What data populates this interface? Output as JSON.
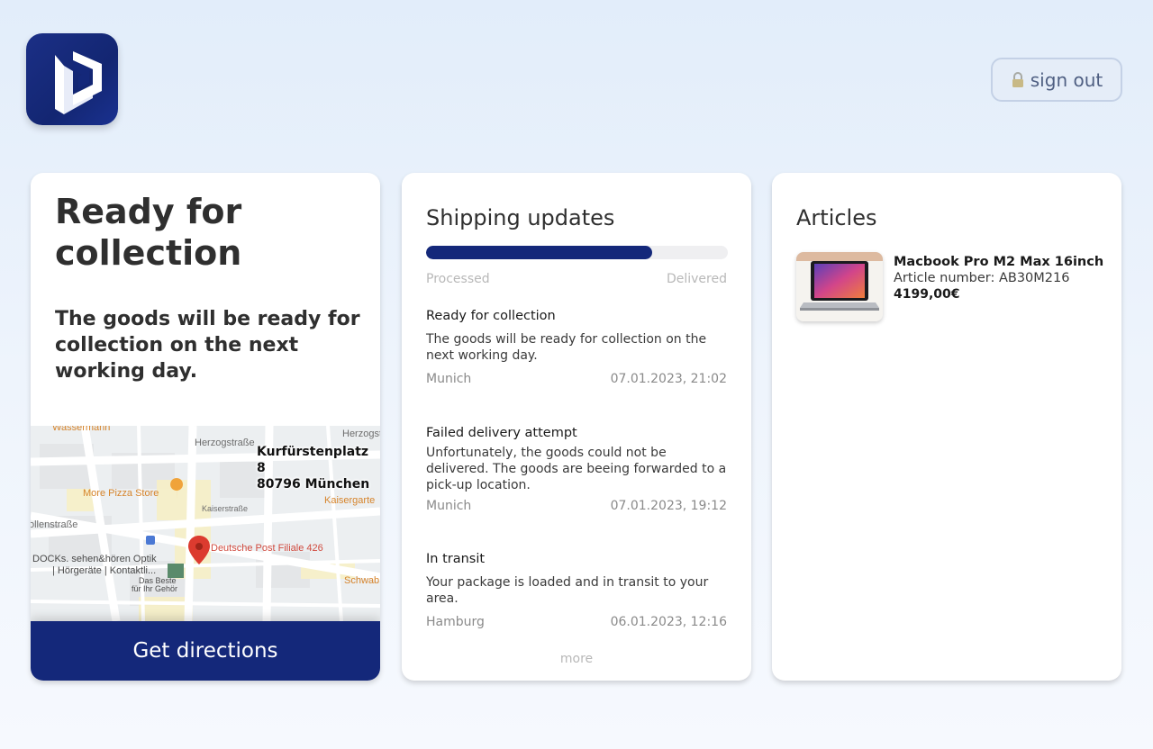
{
  "header": {
    "signout_label": "sign out"
  },
  "status_card": {
    "title": "Ready for collection",
    "description": "The goods will be ready for collection on the next working day.",
    "address_line1": "Kurfürstenplatz 8",
    "address_line2": "80796 München",
    "directions_label": "Get directions",
    "map_labels": {
      "poi_pizza": "More Pizza Store",
      "poi_post": "Deutsche Post Filiale 426",
      "poi_optik": "DOCKs. sehen&hören Optik",
      "poi_optik2": "| Hörgeräte | Kontaktli...",
      "poi_das_beste": "Das Beste",
      "poi_gehoer": "für Ihr Gehör",
      "street_herzog": "Herzogstraße",
      "street_herzog2": "Herzogst",
      "street_kaiser": "Kaiserstraße",
      "street_kaiser2": "Kaisergarte",
      "street_wassermann": "Wassermann",
      "street_ollen": "ollenstraße",
      "street_schwab": "Schwab"
    }
  },
  "shipping": {
    "title": "Shipping updates",
    "progress": 0.75,
    "progress_start": "Processed",
    "progress_end": "Delivered",
    "updates": [
      {
        "title": "Ready for collection",
        "text": "The goods will be ready for collection on the next working day.",
        "location": "Munich",
        "datetime": "07.01.2023, 21:02"
      },
      {
        "title": "Failed delivery attempt",
        "text": "Unfortunately, the goods could not be delivered. The goods are beeing forwarded to a pick-up location.",
        "location": "Munich",
        "datetime": "07.01.2023, 19:12"
      },
      {
        "title": "In transit",
        "text": "Your package is loaded and in transit to your area.",
        "location": "Hamburg",
        "datetime": "06.01.2023, 12:16"
      }
    ],
    "more_label": "more"
  },
  "articles": {
    "title": "Articles",
    "items": [
      {
        "name": "Macbook Pro M2 Max 16inch",
        "number": "Article number: AB30M216",
        "price": "4199,00€"
      }
    ]
  },
  "colors": {
    "accent": "#14287a",
    "progress_track": "#efeff1"
  }
}
